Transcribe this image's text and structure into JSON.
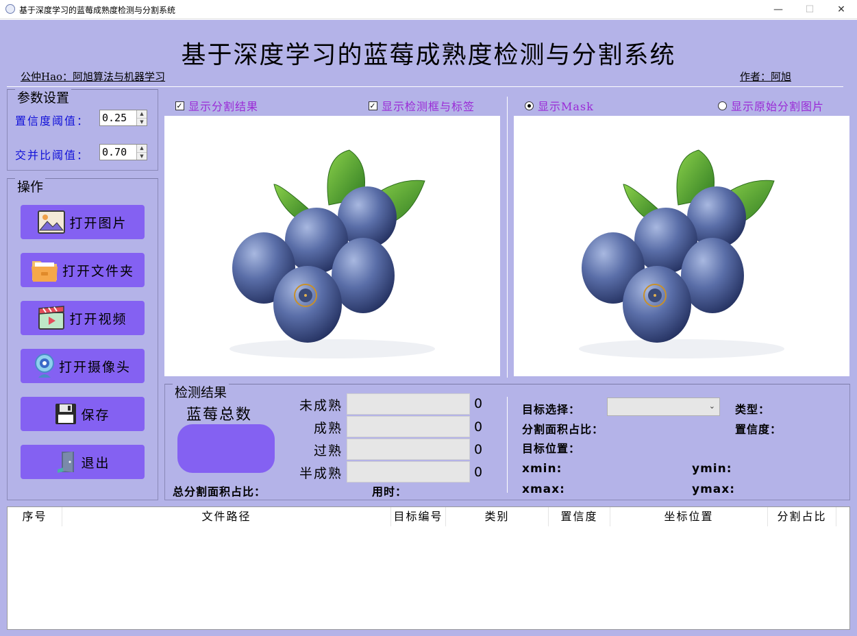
{
  "window": {
    "title": "基于深度学习的蓝莓成熟度检测与分割系统",
    "minimize": "—",
    "maximize": "☐",
    "close": "✕"
  },
  "header": {
    "title": "基于深度学习的蓝莓成熟度检测与分割系统",
    "left_caption": "公仲Hao：阿旭算法与机器学习",
    "right_caption": "作者：阿旭"
  },
  "params": {
    "group_title": "参数设置",
    "confidence_label": "置信度阈值：",
    "confidence_value": "0.25",
    "iou_label": "交并比阈值：",
    "iou_value": "0.70"
  },
  "operations": {
    "group_title": "操作",
    "open_image": "打开图片",
    "open_folder": "打开文件夹",
    "open_video": "打开视频",
    "open_camera": "打开摄像头",
    "save": "保存",
    "exit": "退出"
  },
  "display": {
    "show_seg": "显示分割结果",
    "show_seg_checked": true,
    "show_boxes": "显示检测框与标签",
    "show_boxes_checked": true,
    "show_mask": "显示Mask",
    "show_original_seg": "显示原始分割图片",
    "selected_radio": "show_mask"
  },
  "results": {
    "group_title": "检测结果",
    "total_label": "蓝莓总数",
    "rows": [
      {
        "label": "未成熟",
        "count": "0"
      },
      {
        "label": "成熟",
        "count": "0"
      },
      {
        "label": "过熟",
        "count": "0"
      },
      {
        "label": "半成熟",
        "count": "0"
      }
    ],
    "total_area_label": "总分割面积占比：",
    "time_label": "用时：",
    "target_select_label": "目标选择：",
    "type_label": "类型：",
    "area_ratio_label": "分割面积占比：",
    "confidence_label": "置信度：",
    "position_label": "目标位置：",
    "xmin_label": "xmin:",
    "ymin_label": "ymin:",
    "xmax_label": "xmax:",
    "ymax_label": "ymax:"
  },
  "table": {
    "columns": [
      "序号",
      "文件路径",
      "目标编号",
      "类别",
      "置信度",
      "坐标位置",
      "分割占比"
    ],
    "rows": []
  },
  "colors": {
    "background": "#b4b3e8",
    "button": "#8461f2",
    "param_label": "#1010d8",
    "checkbox_label": "#9a2ad6"
  }
}
